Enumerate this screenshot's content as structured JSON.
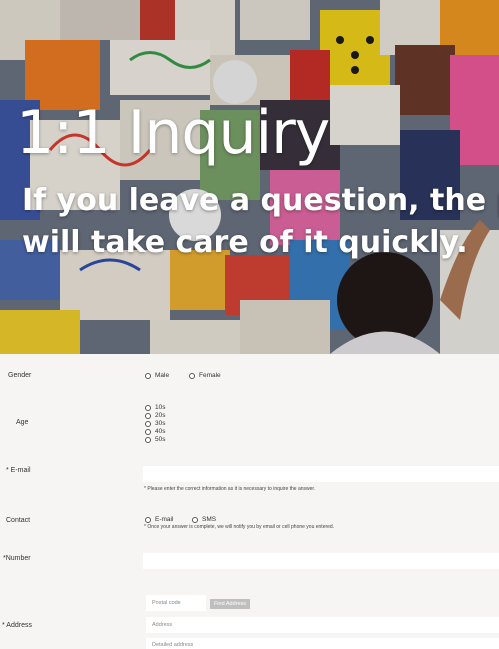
{
  "hero": {
    "title": "1:1 Inquiry",
    "subtitle_line1": "If you leave a question, the person in charge",
    "subtitle_line2": "will take care of it quickly."
  },
  "form": {
    "gender": {
      "label": "Gender",
      "options": [
        "Male",
        "Female"
      ]
    },
    "age": {
      "label": "Age",
      "options": [
        "10s",
        "20s",
        "30s",
        "40s",
        "50s"
      ]
    },
    "email": {
      "label": "* E-mail",
      "hint": "* Please enter the correct information as it is necessary to inquire the answer."
    },
    "contact": {
      "label": "Contact",
      "options": [
        "E-mail",
        "SMS"
      ],
      "hint": "* Once your answer is complete, we will notify you by email or cell phone you entered."
    },
    "number": {
      "label": "*Number"
    },
    "address": {
      "label": "* Address",
      "postal_placeholder": "Postal code",
      "find_button": "Find Address",
      "address_placeholder": "Address",
      "detail_placeholder": "Detailed address"
    }
  }
}
